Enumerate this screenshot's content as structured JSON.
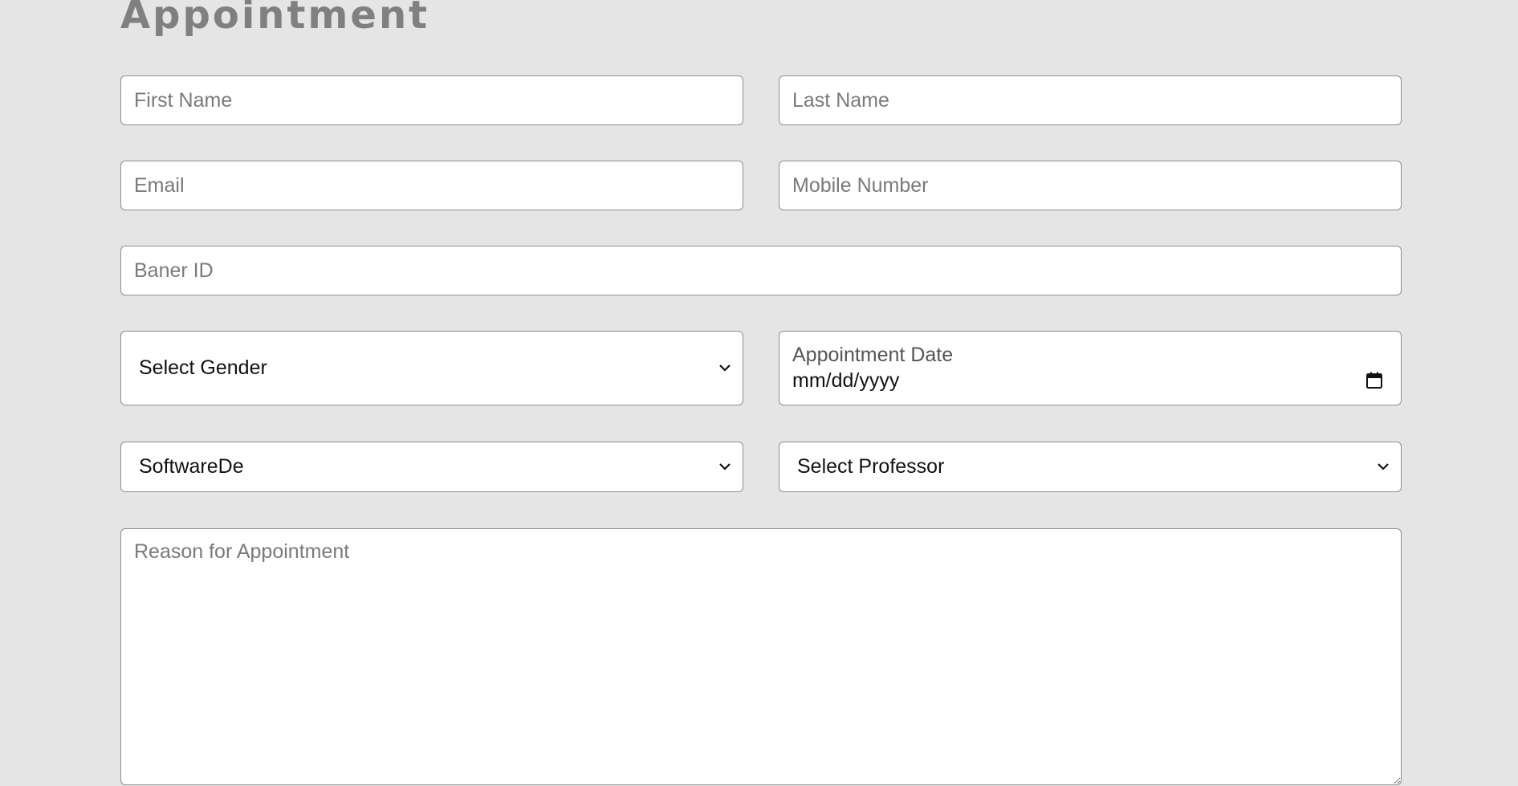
{
  "form": {
    "title": "Appointment",
    "first_name_placeholder": "First Name",
    "last_name_placeholder": "Last Name",
    "email_placeholder": "Email",
    "mobile_placeholder": "Mobile Number",
    "banner_id_placeholder": "Baner ID",
    "gender_select": {
      "selected": "Select Gender"
    },
    "appointment_date": {
      "label": "Appointment Date",
      "value": "mm/dd/yyyy"
    },
    "department_select": {
      "selected": "SoftwareDe"
    },
    "professor_select": {
      "selected": "Select Professor"
    },
    "reason_placeholder": "Reason for Appointment"
  },
  "icons": {
    "select_chevron": "chevron-down-icon",
    "date_picker": "calendar-icon"
  },
  "colors": {
    "background": "#e5e5e5",
    "title": "#808080",
    "field_border": "#8f8f8f",
    "field_background": "#ffffff"
  }
}
